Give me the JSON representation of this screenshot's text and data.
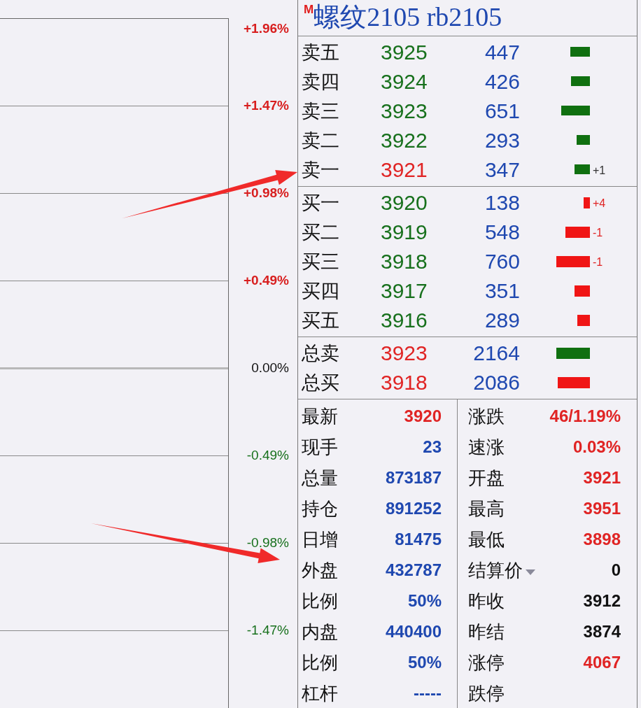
{
  "chart": {
    "axis_labels": [
      {
        "text": "+1.96%",
        "kind": "up"
      },
      {
        "text": "+1.47%",
        "kind": "up"
      },
      {
        "text": "+0.98%",
        "kind": "up"
      },
      {
        "text": "+0.49%",
        "kind": "up"
      },
      {
        "text": "0.00%",
        "kind": "flat"
      },
      {
        "text": "-0.49%",
        "kind": "down"
      },
      {
        "text": "-0.98%",
        "kind": "down"
      },
      {
        "text": "-1.47%",
        "kind": "down"
      }
    ]
  },
  "quote": {
    "market_badge": "M",
    "title": "螺纹2105 rb2105",
    "asks": [
      {
        "label": "卖五",
        "price": {
          "text": "3925",
          "color": "#17701c"
        },
        "volume": "447",
        "bar": {
          "color": "#107010"
        }
      },
      {
        "label": "卖四",
        "price": {
          "text": "3924",
          "color": "#17701c"
        },
        "volume": "426",
        "bar": {
          "color": "#107010"
        }
      },
      {
        "label": "卖三",
        "price": {
          "text": "3923",
          "color": "#17701c"
        },
        "volume": "651",
        "bar": {
          "color": "#107010"
        }
      },
      {
        "label": "卖二",
        "price": {
          "text": "3922",
          "color": "#17701c"
        },
        "volume": "293",
        "bar": {
          "color": "#107010"
        }
      },
      {
        "label": "卖一",
        "price": {
          "text": "3921",
          "color": "#e02424"
        },
        "volume": "347",
        "bar": {
          "color": "#107010"
        },
        "change": {
          "text": "+1",
          "color": "#333333"
        }
      }
    ],
    "bids": [
      {
        "label": "买一",
        "price": {
          "text": "3920",
          "color": "#17701c"
        },
        "volume": "138",
        "bar": {
          "color": "#f01515"
        },
        "change": {
          "text": "+4",
          "color": "#e02424"
        }
      },
      {
        "label": "买二",
        "price": {
          "text": "3919",
          "color": "#17701c"
        },
        "volume": "548",
        "bar": {
          "color": "#f01515"
        },
        "change": {
          "text": "-1",
          "color": "#e02424"
        }
      },
      {
        "label": "买三",
        "price": {
          "text": "3918",
          "color": "#17701c"
        },
        "volume": "760",
        "bar": {
          "color": "#f01515"
        },
        "change": {
          "text": "-1",
          "color": "#e02424"
        }
      },
      {
        "label": "买四",
        "price": {
          "text": "3917",
          "color": "#17701c"
        },
        "volume": "351",
        "bar": {
          "color": "#f01515"
        }
      },
      {
        "label": "买五",
        "price": {
          "text": "3916",
          "color": "#17701c"
        },
        "volume": "289",
        "bar": {
          "color": "#f01515"
        }
      }
    ],
    "totals": [
      {
        "label": "总卖",
        "price": {
          "text": "3923",
          "color": "#e02424"
        },
        "volume": "2164",
        "bar": {
          "color": "#107010"
        }
      },
      {
        "label": "总买",
        "price": {
          "text": "3918",
          "color": "#e02424"
        },
        "volume": "2086",
        "bar": {
          "color": "#f01515"
        }
      }
    ]
  },
  "stats": {
    "left": [
      {
        "label": "最新",
        "value": "3920",
        "color": "#e02424"
      },
      {
        "label": "现手",
        "value": "23",
        "color": "#1f48b0"
      },
      {
        "label": "总量",
        "value": "873187",
        "color": "#1f48b0"
      },
      {
        "label": "持仓",
        "value": "891252",
        "color": "#1f48b0"
      },
      {
        "label": "日增",
        "value": "81475",
        "color": "#1f48b0"
      },
      {
        "label": "外盘",
        "value": "432787",
        "color": "#1f48b0"
      },
      {
        "label": "比例",
        "value": "50%",
        "color": "#1f48b0"
      },
      {
        "label": "内盘",
        "value": "440400",
        "color": "#1f48b0"
      },
      {
        "label": "比例",
        "value": "50%",
        "color": "#1f48b0"
      },
      {
        "label": "杠杆",
        "value": "-----",
        "color": "#1f48b0"
      }
    ],
    "right": [
      {
        "label": "涨跌",
        "value": "46/1.19%",
        "color": "#e02424",
        "dropdown": false
      },
      {
        "label": "速涨",
        "value": "0.03%",
        "color": "#e02424",
        "dropdown": false
      },
      {
        "label": "开盘",
        "value": "3921",
        "color": "#e02424",
        "dropdown": false
      },
      {
        "label": "最高",
        "value": "3951",
        "color": "#e02424",
        "dropdown": false
      },
      {
        "label": "最低",
        "value": "3898",
        "color": "#e02424",
        "dropdown": false
      },
      {
        "label": "结算价",
        "value": "0",
        "color": "#111111",
        "dropdown": true
      },
      {
        "label": "昨收",
        "value": "3912",
        "color": "#111111",
        "dropdown": false
      },
      {
        "label": "昨结",
        "value": "3874",
        "color": "#111111",
        "dropdown": false
      },
      {
        "label": "涨停",
        "value": "4067",
        "color": "#e02424",
        "dropdown": false
      },
      {
        "label": "跌停",
        "dropdown": false
      }
    ]
  }
}
